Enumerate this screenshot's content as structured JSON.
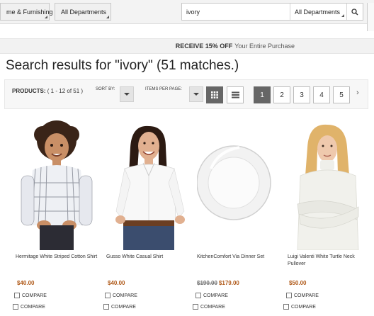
{
  "header": {
    "dept_tab_left": "me & Furnishing",
    "dept_tab_all": "All Departments"
  },
  "search": {
    "value": "ivory",
    "category": "All Departments"
  },
  "promo": {
    "bold": "RECEIVE 15% OFF",
    "text": "Your Entire Purchase"
  },
  "results": {
    "title": "Search results for \"ivory\" (51 matches.)"
  },
  "toolbar": {
    "products_label": "PRODUCTS:",
    "products_range": "( 1 - 12 of 51 )",
    "sort_label": "SORT BY:",
    "items_label": "ITEMS PER PAGE:",
    "pages": [
      "1",
      "2",
      "3",
      "4",
      "5"
    ],
    "current_page": "1",
    "next": "›"
  },
  "products": [
    {
      "name": "Hermitage White Striped Cotton Shirt",
      "price": "$40.00",
      "old_price": "",
      "compare": "COMPARE"
    },
    {
      "name": "Gusso White Casual Shirt",
      "price": "$40.00",
      "old_price": "",
      "compare": "COMPARE"
    },
    {
      "name": "KitchenComfort Via Dinner Set",
      "price": "$179.00",
      "old_price": "$190.00",
      "compare": "COMPARE"
    },
    {
      "name": "Luigi Valenti White Turtle Neck Pullover",
      "price": "$50.00",
      "old_price": "",
      "compare": "COMPARE"
    }
  ],
  "compare_row2": "COMPARE",
  "colors": {
    "price": "#b05a1a",
    "active_page": "#666666"
  },
  "icons": {
    "search": "search-icon",
    "grid_view": "grid-view-icon",
    "list_view": "list-view-icon"
  }
}
